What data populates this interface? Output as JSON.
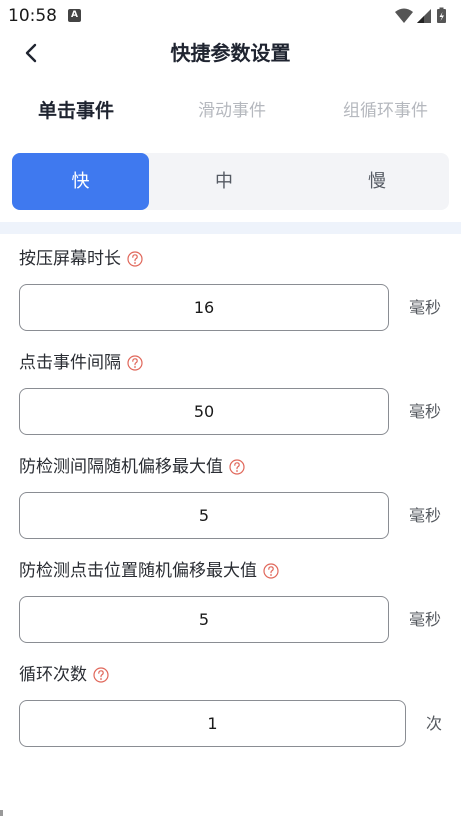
{
  "status": {
    "time": "10:58",
    "notification_letter": "A"
  },
  "header": {
    "title": "快捷参数设置"
  },
  "tabs": [
    {
      "label": "单击事件",
      "active": true
    },
    {
      "label": "滑动事件",
      "active": false
    },
    {
      "label": "组循环事件",
      "active": false
    }
  ],
  "speed": [
    {
      "label": "快",
      "active": true
    },
    {
      "label": "中",
      "active": false
    },
    {
      "label": "慢",
      "active": false
    }
  ],
  "fields": [
    {
      "label": "按压屏幕时长",
      "value": "16",
      "unit": "毫秒"
    },
    {
      "label": "点击事件间隔",
      "value": "50",
      "unit": "毫秒"
    },
    {
      "label": "防检测间隔随机偏移最大值",
      "value": "5",
      "unit": "毫秒"
    },
    {
      "label": "防检测点击位置随机偏移最大值",
      "value": "5",
      "unit": "毫秒"
    },
    {
      "label": "循环次数",
      "value": "1",
      "unit": "次"
    }
  ],
  "colors": {
    "accent": "#3f79ef",
    "help_icon": "#e0675a",
    "inactive_tab": "#b5b8be"
  }
}
